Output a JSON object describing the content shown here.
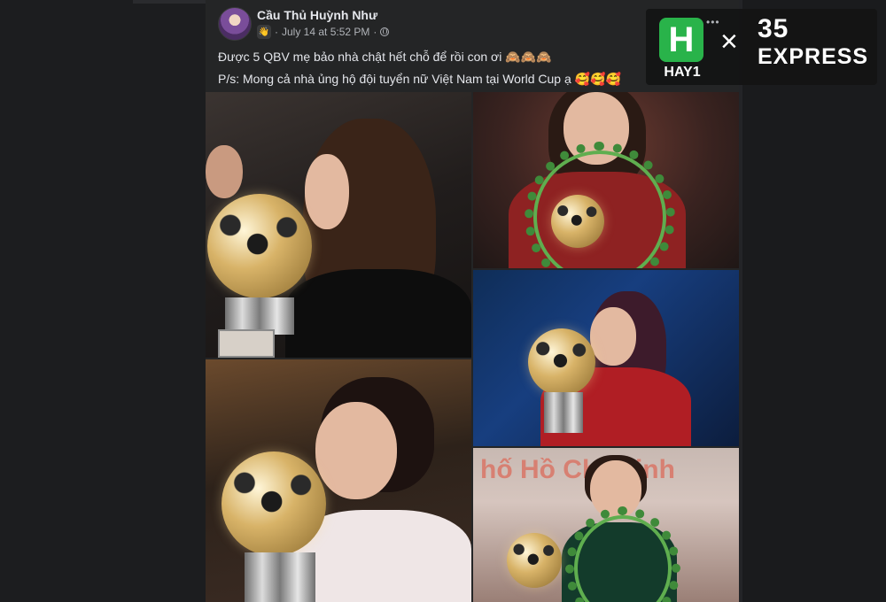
{
  "post": {
    "author": "Cầu Thủ Huỳnh Như",
    "timestamp": "July 14 at 5:52 PM",
    "separator": "·",
    "group_badge_icon": "👋",
    "text_line_1": "Được 5 QBV mẹ bảo nhà chật hết chỗ để rồi con ơi 🙈🙈🙈",
    "text_line_2": "P/s: Mong cả nhà ủng hộ đội tuyển nữ Việt Nam tại World Cup ạ 🥰🥰🥰"
  },
  "gallery": {
    "photo_count": 5,
    "sign_text": "hố Hồ Chí Minh"
  },
  "watermark": {
    "brand_left": "HAY1",
    "logo_letter": "H",
    "times": "×",
    "brand_right_number": "35",
    "brand_right_word": "EXPRESS",
    "more": "•••",
    "accent_color": "#29b34a"
  }
}
